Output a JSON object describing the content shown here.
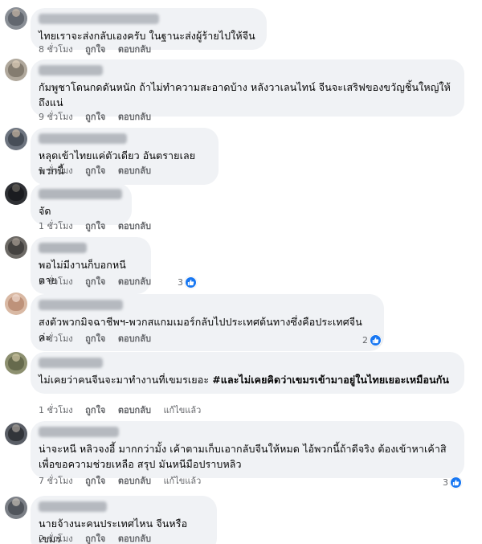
{
  "actions": {
    "like": "ถูกใจ",
    "reply": "ตอบกลับ",
    "edited": "แก้ไขแล้ว"
  },
  "colors": {
    "bubble": "#f0f2f5",
    "meta_text": "#65676b",
    "like_blue": "#1877f2"
  },
  "icons": {
    "like": "thumbs-up-icon"
  },
  "comments": [
    {
      "text": "ไทยเราจะส่งกลับเองครับ ในฐานะส่งผู้ร้ายไปให้จีน",
      "time": "8 ชั่วโมง"
    },
    {
      "text": "กัมพูชาโดนกดดันหนัก ถ้าไม่ทำความสะอาดบ้าง หลังวาเลนไทน์ จีนจะเสริฟของขวัญชิ้นใหญ่ให้ถึงแน่",
      "time": "9 ชั่วโมง"
    },
    {
      "text": "หลุดเข้าไทยแค่ตัวเดียว อันตรายเลยพวกนี้",
      "time": "1 ชั่วโมง"
    },
    {
      "text": "จัด",
      "time": "1 ชั่วโมง"
    },
    {
      "text": "พอไม่มีงานก็บอกหนีตาย",
      "time": "3 ชั่วโมง",
      "reactions": "3"
    },
    {
      "text": "สงตัวพวกมิจฉาชีพฯ-พวกสแกมเมอร์กลับไปประเทศต้นทางซึ่งคือประเทศจีนค่ะ",
      "time": "9 ชั่วโมง",
      "reactions": "2"
    },
    {
      "text_plain": "ไม่เคยว่าคนจีนจะมาทำงานที่เขมรเยอะ ",
      "text_bold": "#และไม่เคยคิดว่าเขมรเข้ามาอยู่ในไทยเยอะเหมือนกัน",
      "time": "1 ชั่วโมง",
      "edited": true
    },
    {
      "text": "น่าจะหนี หลิวจงอี้ มากกว่ามั้ง เค้าตามเก็บเอากลับจีนให้หมด ไอ้พวกนี้ถ้าดีจริง ต้องเข้าหาเค้าสิเพื่อขอความช่วยเหลือ สรุป มันหนีมือปราบหลิว",
      "time": "7 ชั่วโมง",
      "edited": true,
      "reactions": "3"
    },
    {
      "text": "นายจ้างนะคนประเทศไหน จีนหรือเขมร",
      "time": "2 ชั่วโมง"
    }
  ]
}
